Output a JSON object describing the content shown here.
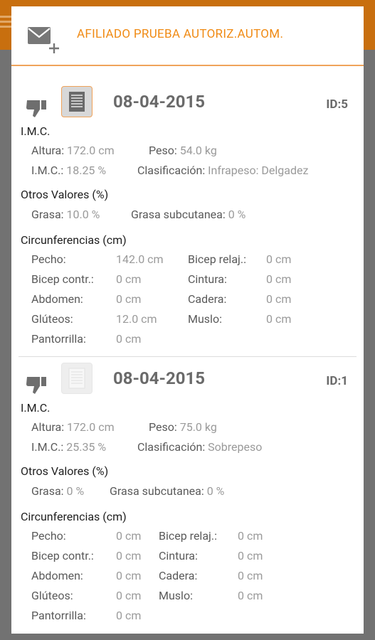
{
  "header": {
    "title": "AFILIADO PRUEBA AUTORIZ.AUTOM."
  },
  "records": [
    {
      "date": "08-04-2015",
      "id": "ID:5",
      "imc_title": "I.M.C.",
      "altura_label": "Altura:",
      "altura_value": "172.0 cm",
      "peso_label": "Peso:",
      "peso_value": "54.0 kg",
      "imc_label": "I.M.C.:",
      "imc_value": "18.25 %",
      "clasif_label": "Clasificación:",
      "clasif_value": "Infrapeso: Delgadez",
      "otros_title": "Otros Valores (%)",
      "grasa_label": "Grasa:",
      "grasa_value": "10.0 %",
      "grasa_sub_label": "Grasa subcutanea:",
      "grasa_sub_value": "0 %",
      "circ_title": "Circunferencias (cm)",
      "pecho_label": "Pecho:",
      "pecho_value": "142.0 cm",
      "bicep_relaj_label": "Bicep relaj.:",
      "bicep_relaj_value": "0 cm",
      "bicep_contr_label": "Bicep contr.:",
      "bicep_contr_value": "0 cm",
      "cintura_label": "Cintura:",
      "cintura_value": "0 cm",
      "abdomen_label": "Abdomen:",
      "abdomen_value": "0 cm",
      "cadera_label": "Cadera:",
      "cadera_value": "0 cm",
      "gluteos_label": "Glúteos:",
      "gluteos_value": "12.0 cm",
      "muslo_label": "Muslo:",
      "muslo_value": "0 cm",
      "pantorrilla_label": "Pantorrilla:",
      "pantorrilla_value": "0 cm"
    },
    {
      "date": "08-04-2015",
      "id": "ID:1",
      "imc_title": "I.M.C.",
      "altura_label": "Altura:",
      "altura_value": "172.0 cm",
      "peso_label": "Peso:",
      "peso_value": "75.0 kg",
      "imc_label": "I.M.C.:",
      "imc_value": "25.35 %",
      "clasif_label": "Clasificación:",
      "clasif_value": "Sobrepeso",
      "otros_title": "Otros Valores (%)",
      "grasa_label": "Grasa:",
      "grasa_value": "0 %",
      "grasa_sub_label": "Grasa subcutanea:",
      "grasa_sub_value": "0 %",
      "circ_title": "Circunferencias (cm)",
      "pecho_label": "Pecho:",
      "pecho_value": "0 cm",
      "bicep_relaj_label": "Bicep relaj.:",
      "bicep_relaj_value": "0 cm",
      "bicep_contr_label": "Bicep contr.:",
      "bicep_contr_value": "0 cm",
      "cintura_label": "Cintura:",
      "cintura_value": "0 cm",
      "abdomen_label": "Abdomen:",
      "abdomen_value": "0 cm",
      "cadera_label": "Cadera:",
      "cadera_value": "0 cm",
      "gluteos_label": "Glúteos:",
      "gluteos_value": "0 cm",
      "muslo_label": "Muslo:",
      "muslo_value": "0 cm",
      "pantorrilla_label": "Pantorrilla:",
      "pantorrilla_value": "0 cm"
    }
  ],
  "icons": {
    "header": "mail-add-icon",
    "rating": "thumbs-down-icon",
    "document": "document-icon"
  },
  "colors": {
    "accent": "#f08a13",
    "header_divider": "#f0a35a",
    "date_text": "#6a6a6a",
    "value_text": "#9a9a9a"
  }
}
